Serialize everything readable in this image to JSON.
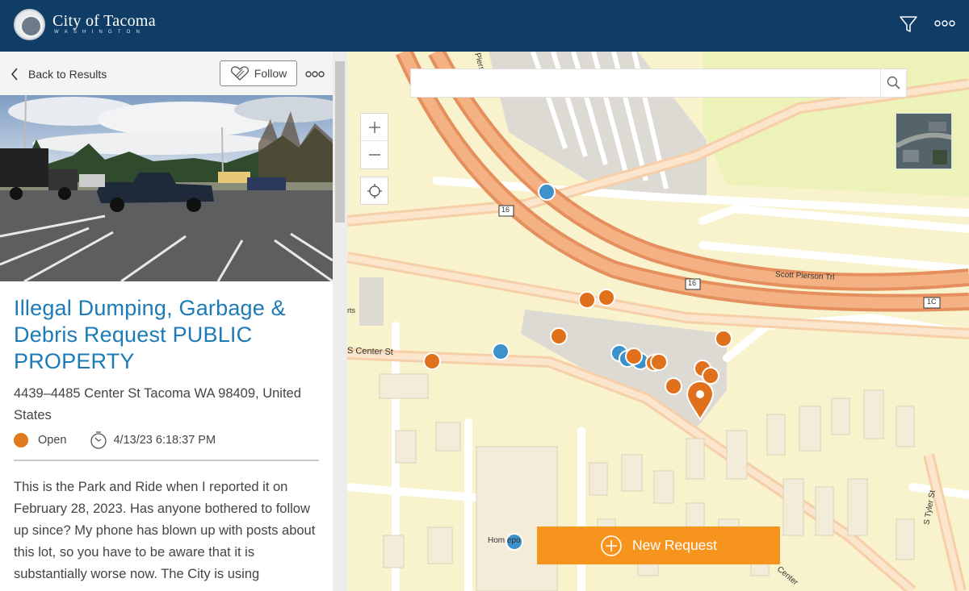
{
  "header": {
    "brand_name": "City of Tacoma",
    "brand_sub": "WASHINGTON",
    "bg_color": "#0f3d66"
  },
  "panel": {
    "back_label": "Back to Results",
    "follow_label": "Follow",
    "title": "Illegal Dumping, Garbage & Debris Request PUBLIC PROPERTY",
    "address": "4439–4485 Center St Tacoma WA 98409, United States",
    "status": "Open",
    "status_color": "#e07a1c",
    "timestamp": "4/13/23 6:18:37 PM",
    "description": "This is the Park and Ride when I reported it on February 28, 2023. Has anyone bothered to follow up since? My phone has blown up with posts about this lot, so you have to be aware that it is substantially worse now. The City is using"
  },
  "map": {
    "search_placeholder": "",
    "street_labels": {
      "center_st_w": "S Center St",
      "scott_pierson": "Scott Pierson Trl",
      "tyler": "S Tyler St",
      "center_se": "Center",
      "pierson_top": "Pierso",
      "route_16a": "16",
      "route_16b": "16",
      "exit_1c": "1C",
      "arts": "rts",
      "home_depot": "Hom      epo"
    },
    "new_request_label": "New Request",
    "accent_color": "#f7941d",
    "markers": {
      "open_color": "#e0701c",
      "closed_color": "#3d92cc"
    }
  }
}
